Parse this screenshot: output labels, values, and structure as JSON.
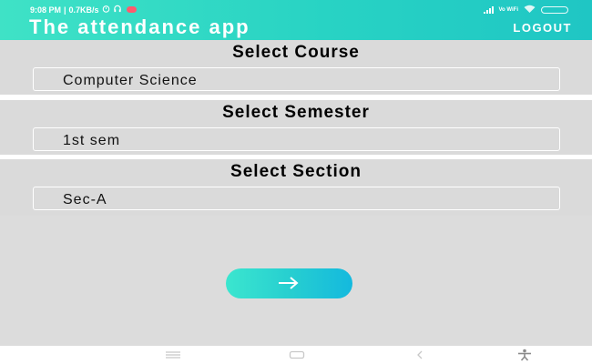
{
  "status_bar": {
    "time": "9:08 PM",
    "separator": "|",
    "net_speed": "0.7KB/s",
    "network_type": "Vo WiFi"
  },
  "app_bar": {
    "title": "The attendance app",
    "logout_label": "LOGOUT"
  },
  "course": {
    "title": "Select Course",
    "selected": "Computer Science"
  },
  "semester": {
    "title": "Select Semester",
    "selected": "1st sem"
  },
  "section": {
    "title": "Select Section",
    "selected": "Sec-A"
  },
  "next_button": {
    "icon": "arrow-right-icon"
  },
  "nav_bar": {
    "icons": [
      "menu-icon",
      "home-icon",
      "back-icon",
      "accessibility-icon"
    ]
  },
  "colors": {
    "accent_start": "#3fe2c6",
    "accent_end": "#14b9de",
    "panel_bg": "#dadada"
  }
}
